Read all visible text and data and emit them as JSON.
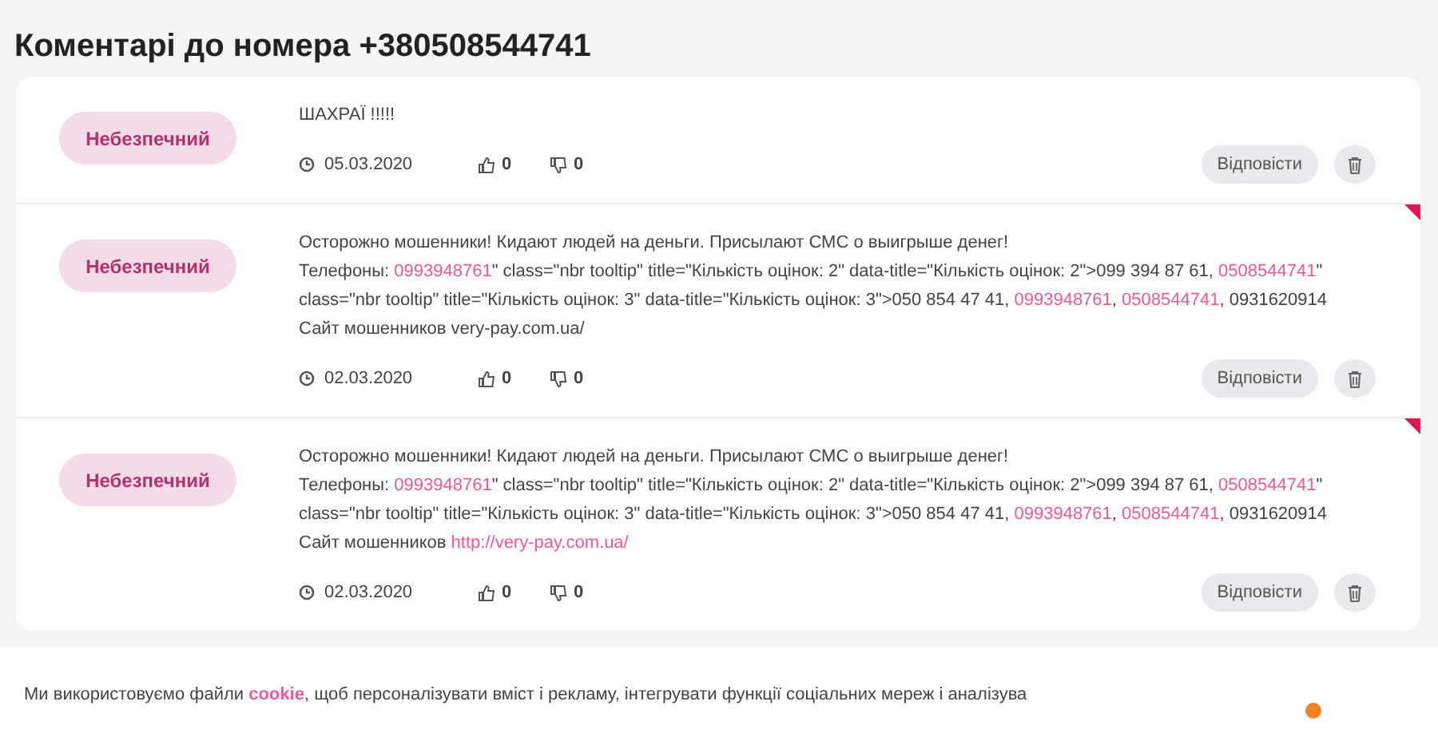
{
  "title": "Коментарі до номера +380508544741",
  "comments": [
    {
      "rating": "Небезпечний",
      "flagged": false,
      "lines": [
        [
          {
            "kind": "plain",
            "text": "ШАХРАЇ !!!!!"
          }
        ]
      ],
      "date": "05.03.2020",
      "likes": "0",
      "dislikes": "0",
      "reply": "Відповісти"
    },
    {
      "rating": "Небезпечний",
      "flagged": true,
      "lines": [
        [
          {
            "kind": "plain",
            "text": "Осторожно мошенники! Кидают людей на деньги. Присылают СМС о выигрыше денег!"
          }
        ],
        [
          {
            "kind": "plain",
            "text": "Телефоны: "
          },
          {
            "kind": "link",
            "text": "0993948761"
          },
          {
            "kind": "plain",
            "text": "\" class=\"nbr tooltip\" title=\"Кількість оцінок: 2\" data-title=\"Кількість оцінок: 2\">099 394 87 61, "
          },
          {
            "kind": "link",
            "text": "0508544741"
          },
          {
            "kind": "plain",
            "text": "\""
          }
        ],
        [
          {
            "kind": "plain",
            "text": "class=\"nbr tooltip\" title=\"Кількість оцінок: 3\" data-title=\"Кількість оцінок: 3\">050 854 47 41, "
          },
          {
            "kind": "link",
            "text": "0993948761"
          },
          {
            "kind": "plain",
            "text": ", "
          },
          {
            "kind": "link",
            "text": "0508544741"
          },
          {
            "kind": "plain",
            "text": ", 0931620914"
          }
        ],
        [
          {
            "kind": "plain",
            "text": "Сайт мошенников very-pay.com.ua/"
          }
        ]
      ],
      "date": "02.03.2020",
      "likes": "0",
      "dislikes": "0",
      "reply": "Відповісти"
    },
    {
      "rating": "Небезпечний",
      "flagged": true,
      "lines": [
        [
          {
            "kind": "plain",
            "text": "Осторожно мошенники! Кидают людей на деньги. Присылают СМС о выигрыше денег!"
          }
        ],
        [
          {
            "kind": "plain",
            "text": "Телефоны: "
          },
          {
            "kind": "link",
            "text": "0993948761"
          },
          {
            "kind": "plain",
            "text": "\" class=\"nbr tooltip\" title=\"Кількість оцінок: 2\" data-title=\"Кількість оцінок: 2\">099 394 87 61, "
          },
          {
            "kind": "link",
            "text": "0508544741"
          },
          {
            "kind": "plain",
            "text": "\""
          }
        ],
        [
          {
            "kind": "plain",
            "text": "class=\"nbr tooltip\" title=\"Кількість оцінок: 3\" data-title=\"Кількість оцінок: 3\">050 854 47 41, "
          },
          {
            "kind": "link",
            "text": "0993948761"
          },
          {
            "kind": "plain",
            "text": ", "
          },
          {
            "kind": "link",
            "text": "0508544741"
          },
          {
            "kind": "plain",
            "text": ", 0931620914"
          }
        ],
        [
          {
            "kind": "plain",
            "text": "Сайт мошенников "
          },
          {
            "kind": "link",
            "text": "http://very-pay.com.ua/"
          }
        ]
      ],
      "date": "02.03.2020",
      "likes": "0",
      "dislikes": "0",
      "reply": "Відповісти"
    }
  ],
  "cookie_bar": {
    "before": "Ми використовуємо файли ",
    "link": "cookie",
    "after": ", щоб персоналізувати вміст і рекламу, інтегрувати функції соціальних мереж і аналізува"
  }
}
